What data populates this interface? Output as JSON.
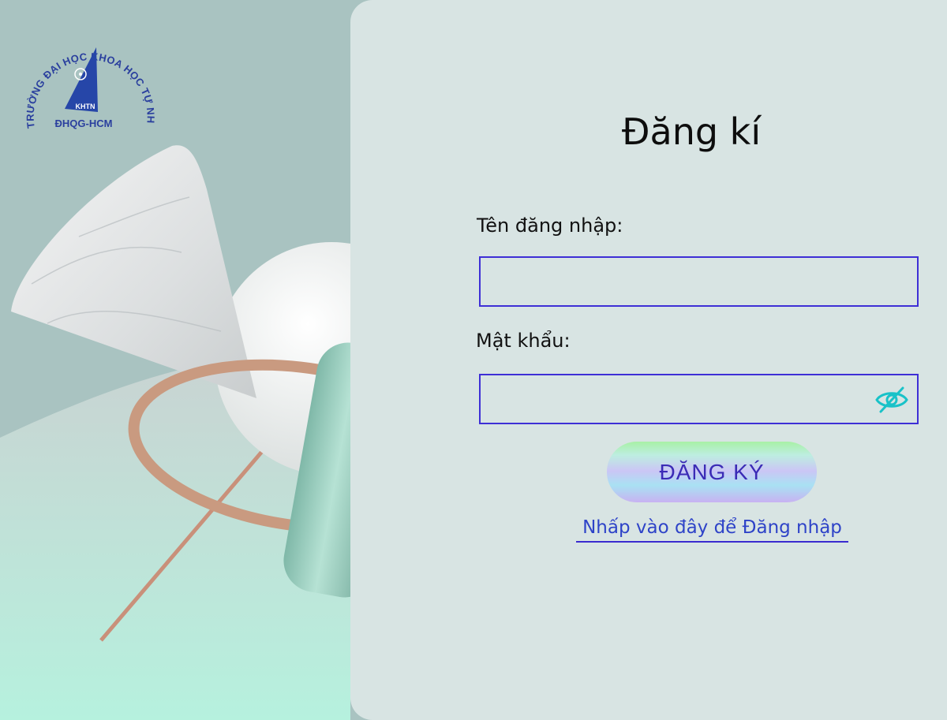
{
  "logo": {
    "arc_text": "TRƯỜNG ĐẠI HỌC KHOA HỌC TỰ NHIÊN",
    "abbr": "KHTN",
    "sub": "ĐHQG-HCM"
  },
  "form": {
    "title": "Đăng kí",
    "username_label": "Tên đăng nhập:",
    "username_value": "",
    "password_label": "Mật khẩu:",
    "password_value": "",
    "submit_label": "ĐĂNG KÝ",
    "login_link": "Nhấp vào đây để Đăng nhập"
  },
  "icons": {
    "password_toggle": "eye-slash-icon"
  },
  "colors": {
    "accent": "#3e2fd6",
    "link": "#2e43c8",
    "eye": "#19c2c8",
    "panel": "#d8e4e3"
  }
}
